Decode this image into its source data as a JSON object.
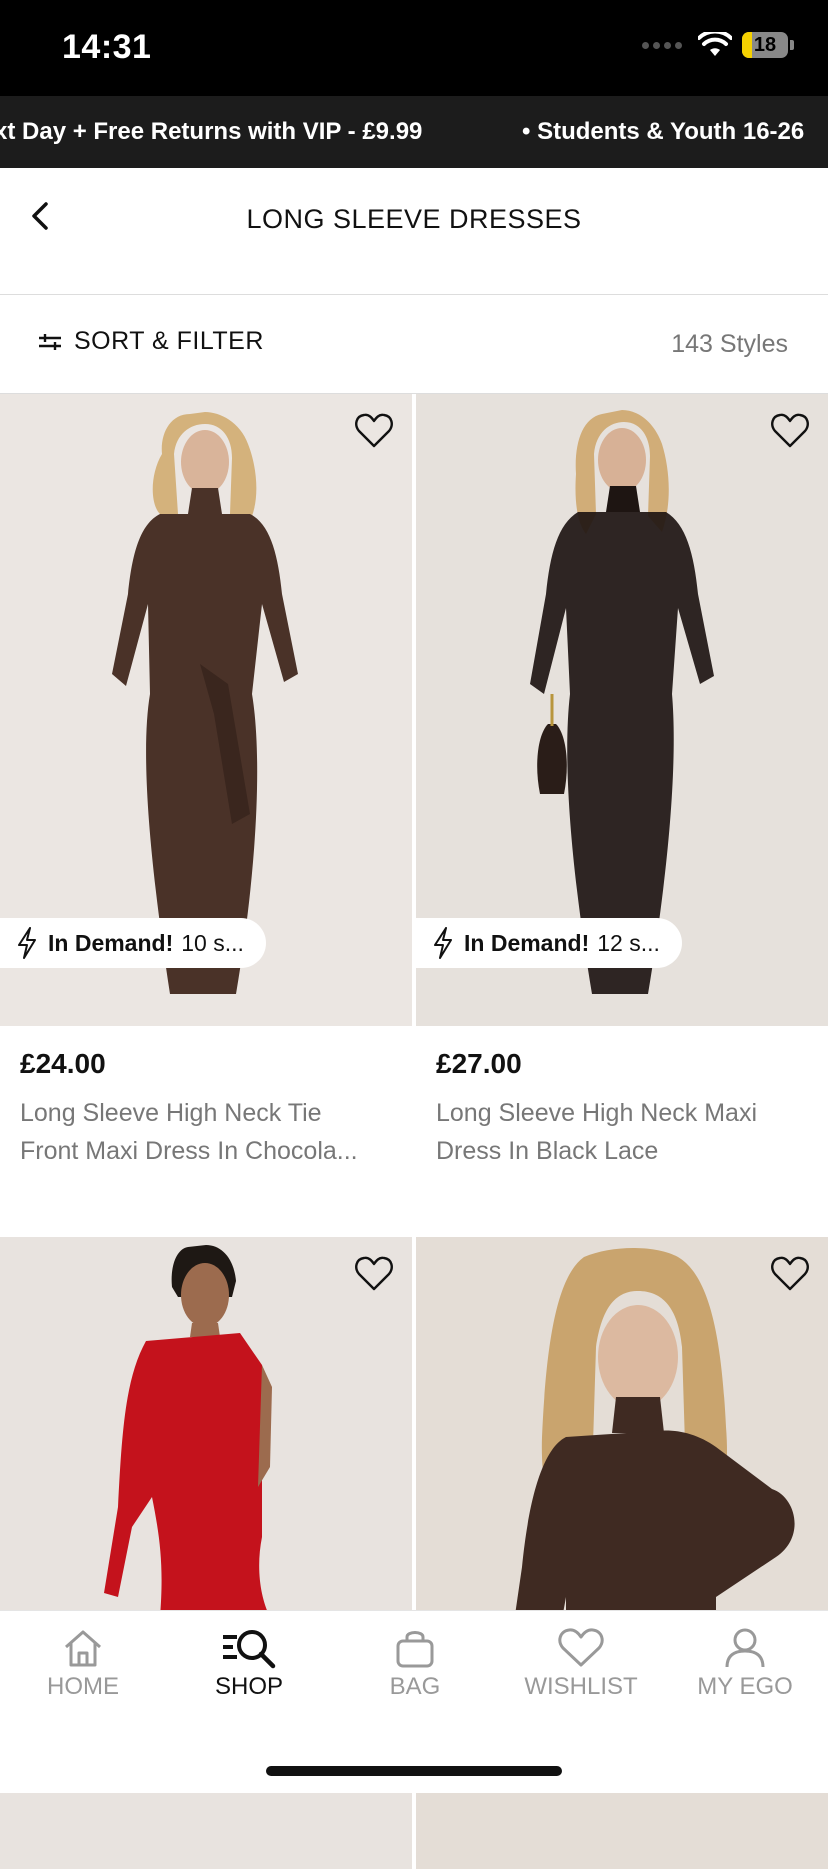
{
  "status_bar": {
    "time": "14:31",
    "battery": "18"
  },
  "promo": {
    "text1": "xt Day + Free Returns with VIP - £9.99",
    "text2": "• Students & Youth 16-26"
  },
  "header": {
    "title": "LONG SLEEVE DRESSES"
  },
  "filter": {
    "label": "SORT & FILTER",
    "count": "143 Styles"
  },
  "products": [
    {
      "price": "£24.00",
      "name_line1": "Long Sleeve High Neck Tie",
      "name_line2": "Front Maxi Dress In Chocola...",
      "badge_bold": "In Demand!",
      "badge_rest": "10 s...",
      "dress_color": "#4a3228"
    },
    {
      "price": "£27.00",
      "name_line1": "Long Sleeve High Neck Maxi",
      "name_line2": "Dress In Black Lace",
      "badge_bold": "In Demand!",
      "badge_rest": "12 s...",
      "dress_color": "#1e1512"
    },
    {
      "dress_color": "#c4121c"
    },
    {
      "dress_color": "#3f2a22"
    }
  ],
  "tabs": [
    {
      "label": "HOME",
      "icon": "home-icon"
    },
    {
      "label": "SHOP",
      "icon": "search-icon"
    },
    {
      "label": "BAG",
      "icon": "bag-icon"
    },
    {
      "label": "WISHLIST",
      "icon": "heart-icon"
    },
    {
      "label": "MY EGO",
      "icon": "user-icon"
    }
  ]
}
